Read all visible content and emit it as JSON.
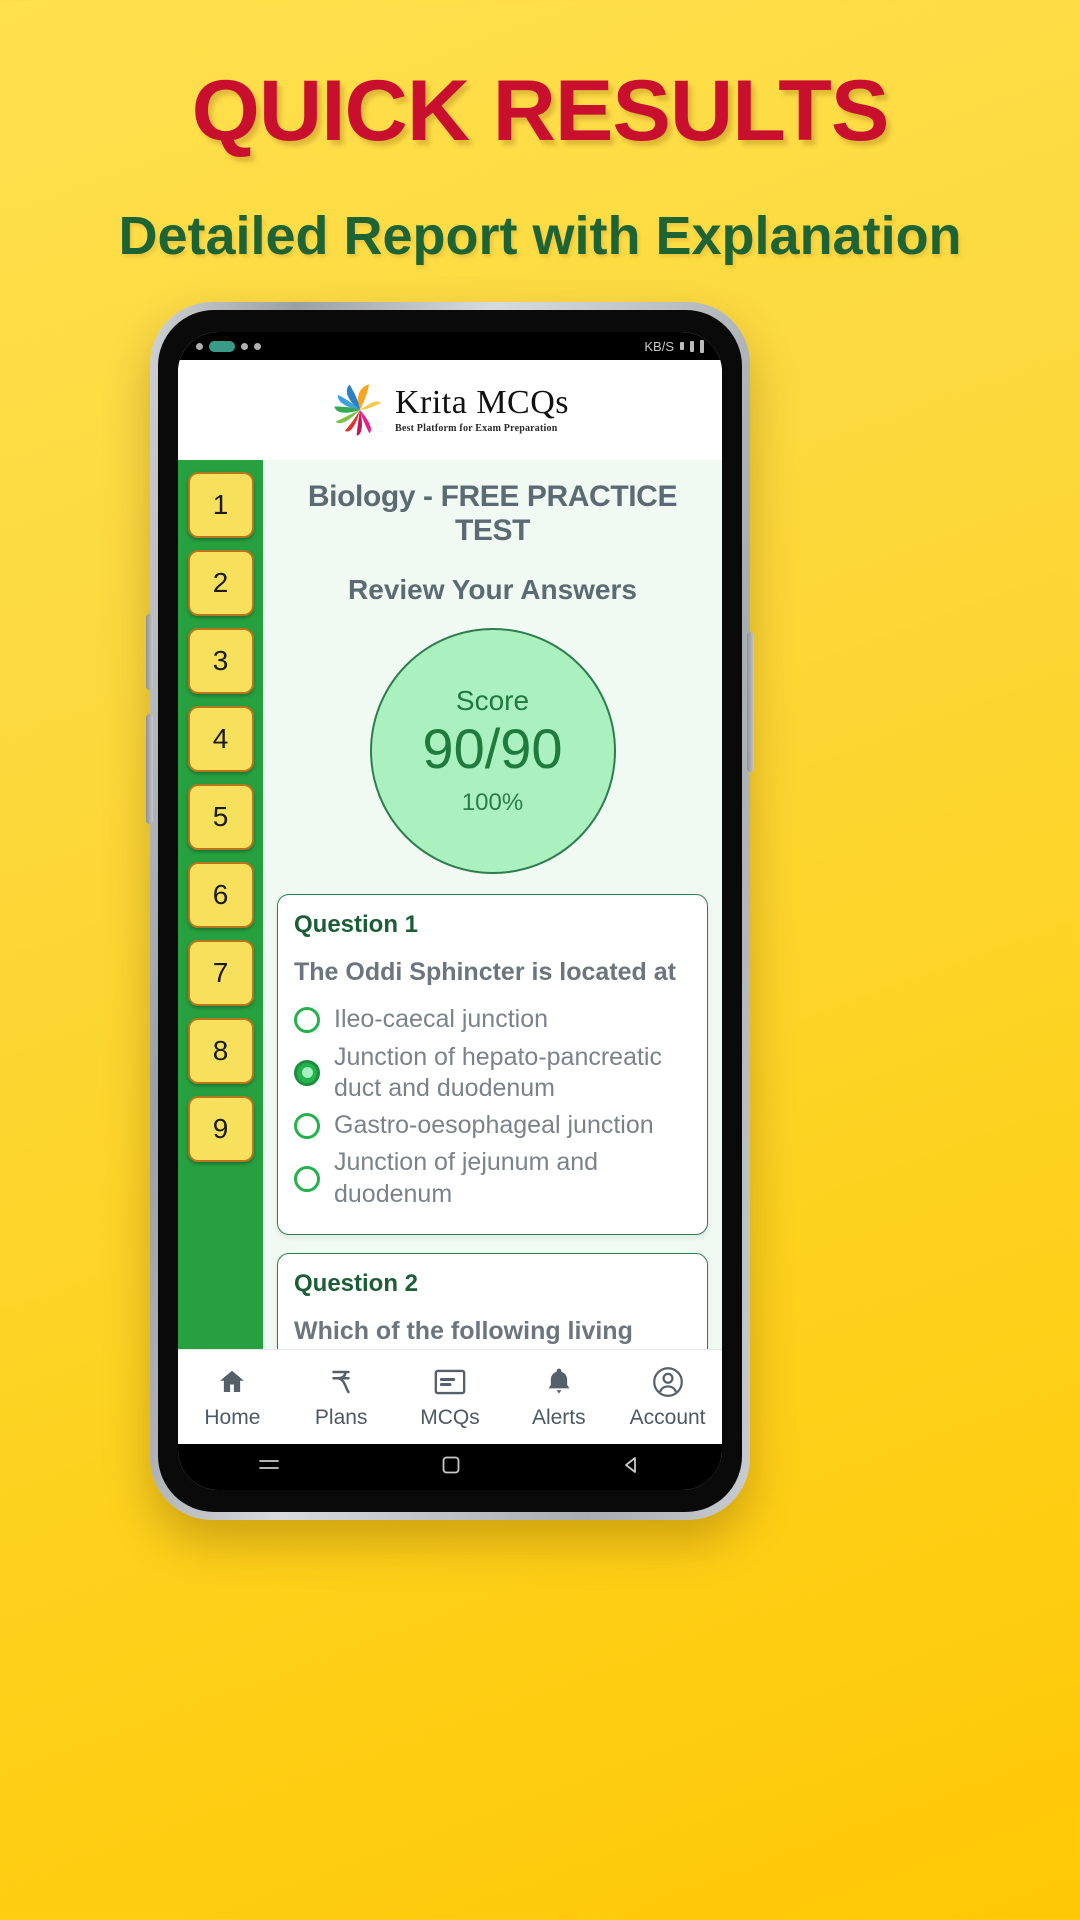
{
  "promo": {
    "title": "QUICK RESULTS",
    "subtitle": "Detailed Report with Explanation",
    "title_color": "#c8102e",
    "subtitle_color": "#1d6333",
    "background_color": "#fcd93f"
  },
  "status_bar": {
    "network_speed": "KB/S"
  },
  "app": {
    "logo_name": "Krita MCQs",
    "logo_tagline": "Best Platform for Exam Preparation",
    "accent_green": "#27a03f",
    "accent_yellow": "#f7e05c"
  },
  "question_nav": {
    "items": [
      "1",
      "2",
      "3",
      "4",
      "5",
      "6",
      "7",
      "8",
      "9"
    ]
  },
  "result": {
    "test_title": "Biology - FREE PRACTICE TEST",
    "review_title": "Review Your Answers",
    "score_label": "Score",
    "score_value": "90/90",
    "score_percent": "100%"
  },
  "questions": [
    {
      "number": "Question 1",
      "text": "The Oddi Sphincter is located at",
      "options": [
        {
          "label": "Ileo-caecal junction",
          "selected": false
        },
        {
          "label": "Junction of hepato-pancreatic duct and duodenum",
          "selected": true
        },
        {
          "label": "Gastro-oesophageal junction",
          "selected": false
        },
        {
          "label": "Junction of jejunum and duodenum",
          "selected": false
        }
      ]
    },
    {
      "number": "Question 2",
      "text": "Which of the following living things has hollow, air-filled long bones?",
      "options": []
    }
  ],
  "bottom_nav": [
    {
      "label": "Home",
      "icon": "home-icon"
    },
    {
      "label": "Plans",
      "icon": "rupee-icon"
    },
    {
      "label": "MCQs",
      "icon": "card-icon"
    },
    {
      "label": "Alerts",
      "icon": "bell-icon"
    },
    {
      "label": "Account",
      "icon": "user-circle-icon"
    }
  ]
}
